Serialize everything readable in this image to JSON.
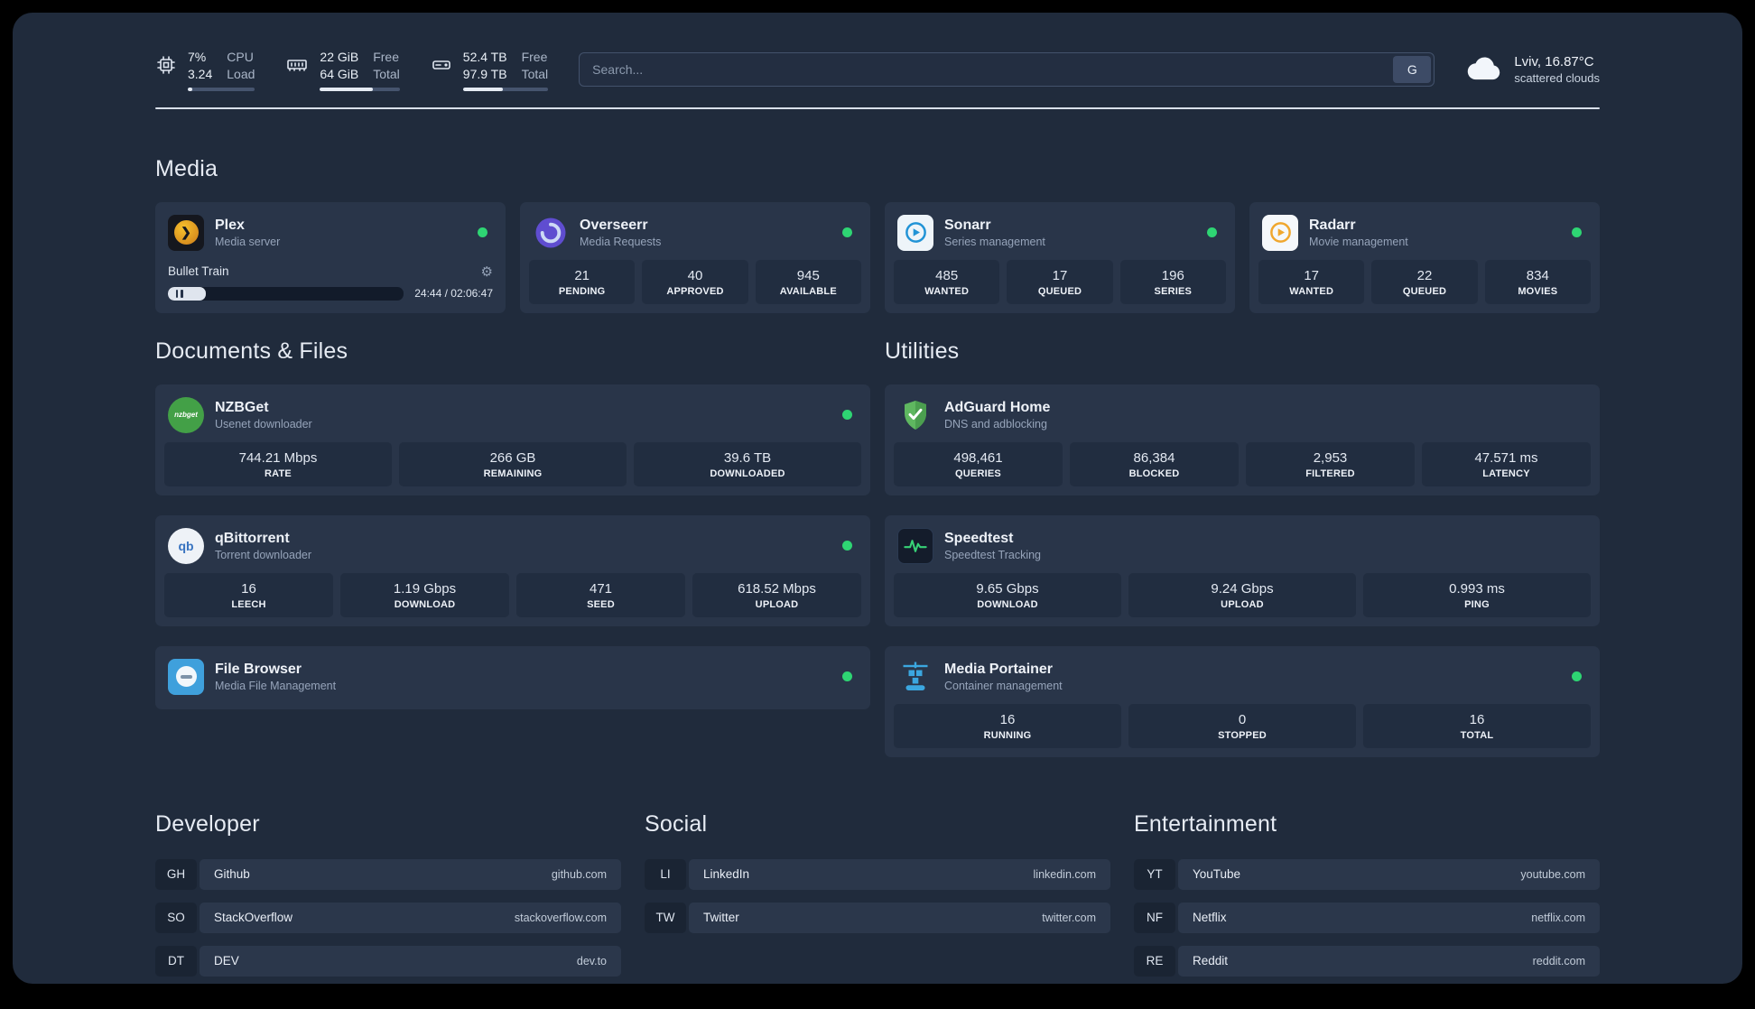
{
  "colors": {
    "background": "#202b3c",
    "card": "#293549",
    "tile": "#212d40",
    "status_online": "#2ed573",
    "plex_amber": "#e5a00d",
    "overseerr_purple": "#5f4dd0",
    "sonarr_blue": "#2193d6",
    "radarr_amber": "#f0a72e",
    "adguard_green": "#5fb760",
    "speedtest_green": "#37d277",
    "portainer_blue": "#3ba7e0"
  },
  "icons": {
    "cpu": "chip-icon",
    "memory": "ram-icon",
    "disk": "drive-icon",
    "weather": "cloud-icon",
    "gear": "⚙",
    "pause": "⏸"
  },
  "topbar": {
    "cpu": {
      "value_top": "7%",
      "value_bottom": "3.24",
      "label_top": "CPU",
      "label_bottom": "Load",
      "progress": 7
    },
    "memory": {
      "value_top": "22 GiB",
      "value_bottom": "64 GiB",
      "label_top": "Free",
      "label_bottom": "Total",
      "progress": 66
    },
    "disk": {
      "value_top": "52.4 TB",
      "value_bottom": "97.9 TB",
      "label_top": "Free",
      "label_bottom": "Total",
      "progress": 47
    },
    "search": {
      "placeholder": "Search...",
      "button": "G"
    },
    "weather": {
      "location": "Lviv, 16.87°C",
      "condition": "scattered clouds"
    }
  },
  "media": {
    "title": "Media",
    "plex": {
      "name": "Plex",
      "subtitle": "Media server",
      "player": {
        "track": "Bullet Train",
        "time": "24:44 / 02:06:47",
        "progress_pct": 16
      }
    },
    "overseerr": {
      "name": "Overseerr",
      "subtitle": "Media Requests",
      "stats": [
        {
          "value": "21",
          "label": "PENDING"
        },
        {
          "value": "40",
          "label": "APPROVED"
        },
        {
          "value": "945",
          "label": "AVAILABLE"
        }
      ]
    },
    "sonarr": {
      "name": "Sonarr",
      "subtitle": "Series management",
      "stats": [
        {
          "value": "485",
          "label": "WANTED"
        },
        {
          "value": "17",
          "label": "QUEUED"
        },
        {
          "value": "196",
          "label": "SERIES"
        }
      ]
    },
    "radarr": {
      "name": "Radarr",
      "subtitle": "Movie management",
      "stats": [
        {
          "value": "17",
          "label": "WANTED"
        },
        {
          "value": "22",
          "label": "QUEUED"
        },
        {
          "value": "834",
          "label": "MOVIES"
        }
      ]
    }
  },
  "documents": {
    "title": "Documents & Files",
    "nzbget": {
      "name": "NZBGet",
      "subtitle": "Usenet downloader",
      "stats": [
        {
          "value": "744.21 Mbps",
          "label": "RATE"
        },
        {
          "value": "266 GB",
          "label": "REMAINING"
        },
        {
          "value": "39.6 TB",
          "label": "DOWNLOADED"
        }
      ]
    },
    "qbittorrent": {
      "name": "qBittorrent",
      "subtitle": "Torrent downloader",
      "stats": [
        {
          "value": "16",
          "label": "LEECH"
        },
        {
          "value": "1.19 Gbps",
          "label": "DOWNLOAD"
        },
        {
          "value": "471",
          "label": "SEED"
        },
        {
          "value": "618.52 Mbps",
          "label": "UPLOAD"
        }
      ]
    },
    "filebrowser": {
      "name": "File Browser",
      "subtitle": "Media File Management"
    }
  },
  "utilities": {
    "title": "Utilities",
    "adguard": {
      "name": "AdGuard Home",
      "subtitle": "DNS and adblocking",
      "stats": [
        {
          "value": "498,461",
          "label": "QUERIES"
        },
        {
          "value": "86,384",
          "label": "BLOCKED"
        },
        {
          "value": "2,953",
          "label": "FILTERED"
        },
        {
          "value": "47.571 ms",
          "label": "LATENCY"
        }
      ]
    },
    "speedtest": {
      "name": "Speedtest",
      "subtitle": "Speedtest Tracking",
      "stats": [
        {
          "value": "9.65 Gbps",
          "label": "DOWNLOAD"
        },
        {
          "value": "9.24 Gbps",
          "label": "UPLOAD"
        },
        {
          "value": "0.993 ms",
          "label": "PING"
        }
      ]
    },
    "portainer": {
      "name": "Media Portainer",
      "subtitle": "Container management",
      "stats": [
        {
          "value": "16",
          "label": "RUNNING"
        },
        {
          "value": "0",
          "label": "STOPPED"
        },
        {
          "value": "16",
          "label": "TOTAL"
        }
      ]
    }
  },
  "bookmarks": {
    "developer": {
      "title": "Developer",
      "items": [
        {
          "abbr": "GH",
          "name": "Github",
          "url": "github.com"
        },
        {
          "abbr": "SO",
          "name": "StackOverflow",
          "url": "stackoverflow.com"
        },
        {
          "abbr": "DT",
          "name": "DEV",
          "url": "dev.to"
        }
      ]
    },
    "social": {
      "title": "Social",
      "items": [
        {
          "abbr": "LI",
          "name": "LinkedIn",
          "url": "linkedin.com"
        },
        {
          "abbr": "TW",
          "name": "Twitter",
          "url": "twitter.com"
        }
      ]
    },
    "entertainment": {
      "title": "Entertainment",
      "items": [
        {
          "abbr": "YT",
          "name": "YouTube",
          "url": "youtube.com"
        },
        {
          "abbr": "NF",
          "name": "Netflix",
          "url": "netflix.com"
        },
        {
          "abbr": "RE",
          "name": "Reddit",
          "url": "reddit.com"
        }
      ]
    }
  }
}
